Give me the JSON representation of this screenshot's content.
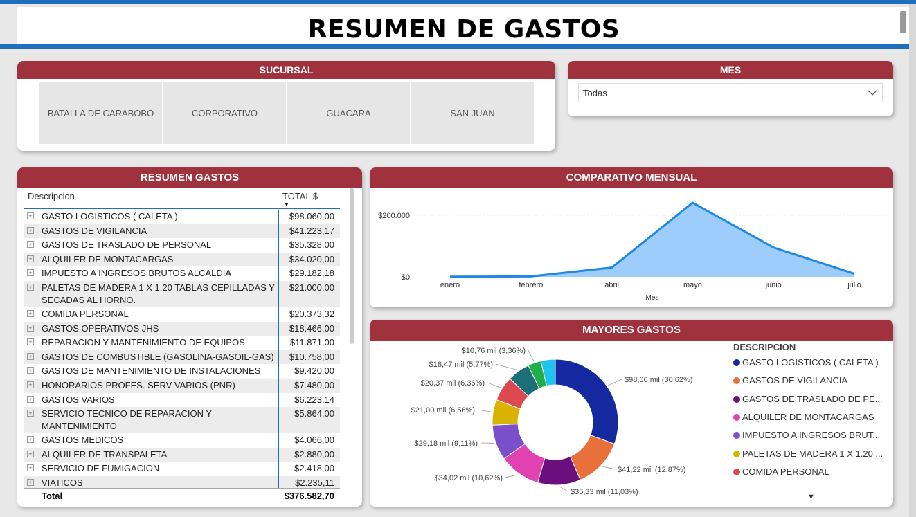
{
  "page": {
    "title": "RESUMEN DE GASTOS"
  },
  "sucursal": {
    "header": "SUCURSAL",
    "options": [
      "BATALLA DE CARABOBO",
      "CORPORATIVO",
      "GUACARA",
      "SAN JUAN"
    ]
  },
  "mes": {
    "header": "MES",
    "selected": "Todas"
  },
  "resumen": {
    "header": "RESUMEN GASTOS",
    "col_desc": "Descripcion",
    "col_total": "TOTAL $",
    "rows": [
      {
        "desc": "GASTO LOGISTICOS ( CALETA )",
        "total": "$98.060,00"
      },
      {
        "desc": "GASTOS DE VIGILANCIA",
        "total": "$41.223,17"
      },
      {
        "desc": "GASTOS DE TRASLADO DE PERSONAL",
        "total": "$35.328,00"
      },
      {
        "desc": "ALQUILER DE MONTACARGAS",
        "total": "$34.020,00"
      },
      {
        "desc": "IMPUESTO A INGRESOS BRUTOS ALCALDIA",
        "total": "$29.182,18"
      },
      {
        "desc": "PALETAS DE MADERA 1 X 1.20 TABLAS CEPILLADAS Y SECADAS AL HORNO.",
        "total": "$21.000,00"
      },
      {
        "desc": "COMIDA PERSONAL",
        "total": "$20.373,32"
      },
      {
        "desc": "GASTOS OPERATIVOS JHS",
        "total": "$18.466,00"
      },
      {
        "desc": "REPARACION Y MANTENIMIENTO DE EQUIPOS",
        "total": "$11.871,00"
      },
      {
        "desc": "GASTOS DE COMBUSTIBLE (GASOLINA-GASOIL-GAS)",
        "total": "$10.758,00"
      },
      {
        "desc": "GASTOS DE MANTENIMIENTO DE INSTALACIONES",
        "total": "$9.420,00"
      },
      {
        "desc": "HONORARIOS PROFES. SERV VARIOS (PNR)",
        "total": "$7.480,00"
      },
      {
        "desc": "GASTOS VARIOS",
        "total": "$6.223,14"
      },
      {
        "desc": "SERVICIO TECNICO DE REPARACION Y MANTENIMIENTO",
        "total": "$5.864,00"
      },
      {
        "desc": "GASTOS MEDICOS",
        "total": "$4.066,00"
      },
      {
        "desc": "ALQUILER DE TRANSPALETA",
        "total": "$2.880,00"
      },
      {
        "desc": "SERVICIO DE FUMIGACION",
        "total": "$2.418,00"
      },
      {
        "desc": "VIATICOS",
        "total": "$2.235,11"
      }
    ],
    "total_label": "Total",
    "total_value": "$376.582,70"
  },
  "comparativo": {
    "header": "COMPARATIVO MENSUAL",
    "chart_data": {
      "type": "area",
      "categories": [
        "enero",
        "febrero",
        "abril",
        "mayo",
        "junio",
        "julio"
      ],
      "values": [
        500,
        1500,
        30000,
        240000,
        95000,
        10000
      ],
      "xlabel": "Mes",
      "ylabel": "",
      "y_ticks": [
        "$0",
        "$200.000"
      ],
      "ylim": [
        0,
        260000
      ],
      "color": "#1e88e5",
      "fill": "#9fcdfb"
    }
  },
  "mayores": {
    "header": "MAYORES GASTOS",
    "legend_title": "DESCRIPCION",
    "chart_data": {
      "type": "pie",
      "slices": [
        {
          "name": "GASTO LOGISTICOS ( CALETA )",
          "value": 98.06,
          "label": "$98,06 mil (30,62%)",
          "color": "#1428a0"
        },
        {
          "name": "GASTOS DE VIGILANCIA",
          "value": 41.22,
          "label": "$41,22 mil (12,87%)",
          "color": "#e8703a"
        },
        {
          "name": "GASTOS DE TRASLADO DE PE...",
          "value": 35.33,
          "label": "$35,33 mil (11,03%)",
          "color": "#6b0f7e"
        },
        {
          "name": "ALQUILER DE MONTACARGAS",
          "value": 34.02,
          "label": "$34,02 mil (10,62%)",
          "color": "#e043b1"
        },
        {
          "name": "IMPUESTO A INGRESOS BRUT...",
          "value": 29.18,
          "label": "$29,18 mil (9,11%)",
          "color": "#7b4fc9"
        },
        {
          "name": "PALETAS DE MADERA 1 X 1.20 ...",
          "value": 21.0,
          "label": "$21,00 mil (6,56%)",
          "color": "#d9b300"
        },
        {
          "name": "COMIDA PERSONAL",
          "value": 20.37,
          "label": "$20,37 mil (6,36%)",
          "color": "#de4850"
        },
        {
          "name": "",
          "value": 18.47,
          "label": "$18,47 mil (5,77%)",
          "color": "#1c6f77"
        },
        {
          "name": "",
          "value": 10.76,
          "label": "$10,76 mil (3,36%)",
          "color": "#1fae4a"
        },
        {
          "name": "",
          "value": 11.87,
          "label": "",
          "color": "#1fc4ee"
        }
      ]
    }
  }
}
